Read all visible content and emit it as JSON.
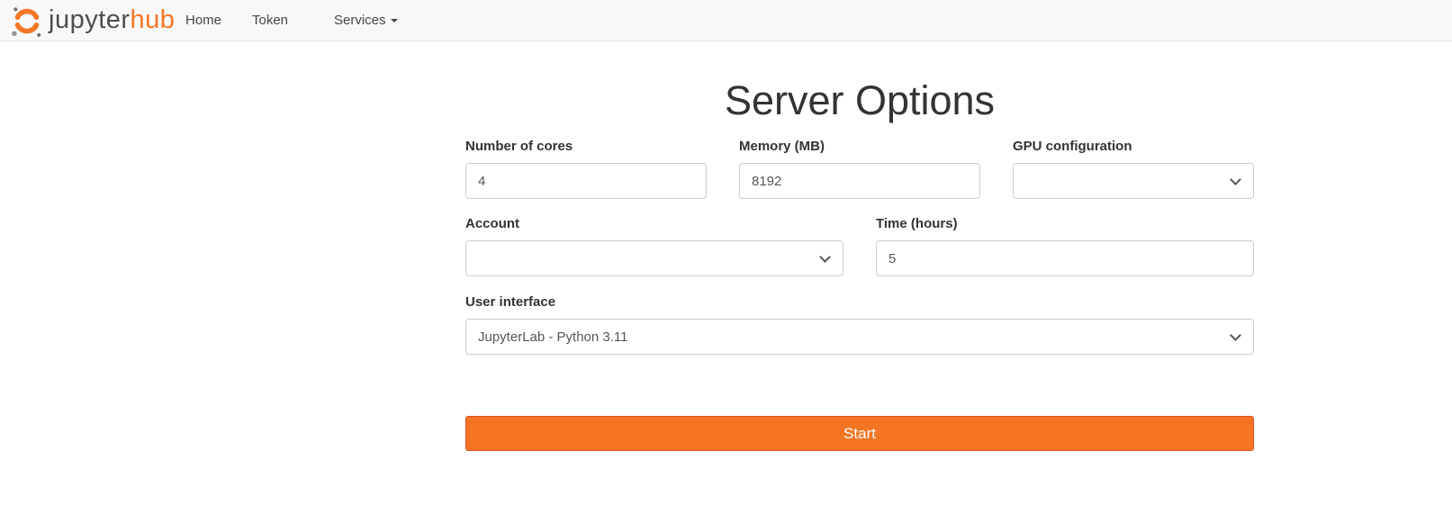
{
  "navbar": {
    "logo": {
      "brand_gray": "jupyter",
      "brand_orange": "hub"
    },
    "items": [
      {
        "label": "Home"
      },
      {
        "label": "Token"
      },
      {
        "label": "Services"
      }
    ]
  },
  "page": {
    "title": "Server Options"
  },
  "form": {
    "number_of_cores": {
      "label": "Number of cores",
      "value": "4"
    },
    "memory": {
      "label": "Memory (MB)",
      "value": "8192"
    },
    "gpu_configuration": {
      "label": "GPU configuration",
      "value": ""
    },
    "account": {
      "label": "Account",
      "value": ""
    },
    "time_hours": {
      "label": "Time (hours)",
      "value": "5"
    },
    "user_interface": {
      "label": "User interface",
      "value": "JupyterLab - Python 3.11"
    },
    "start_button_label": "Start"
  },
  "colors": {
    "accent_orange": "#f37524",
    "button_border": "#e34f21",
    "logo_orange": "#f37626",
    "navbar_bg": "#f8f8f8",
    "navbar_border": "#e7e7e7"
  }
}
